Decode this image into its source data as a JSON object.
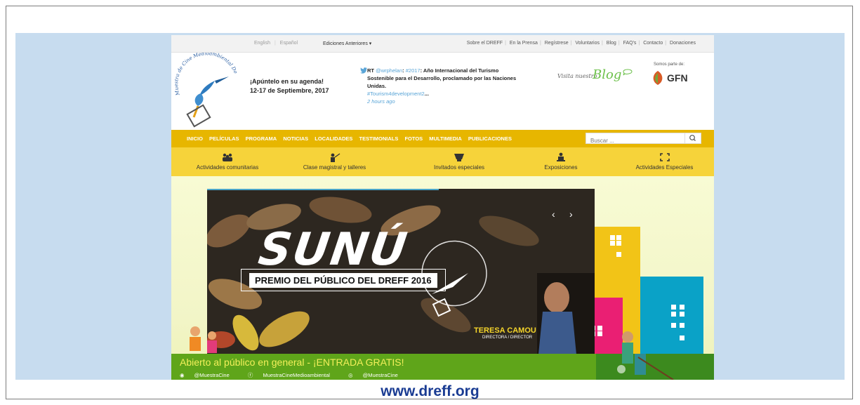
{
  "topbar": {
    "lang_english": "English",
    "lang_espanol": "Español",
    "ediciones": "Ediciones Anteriores",
    "links": [
      "Sobre el DREFF",
      "En la Prensa",
      "Regístrese",
      "Voluntarios",
      "Blog",
      "FAQ's",
      "Contacto",
      "Donaciones"
    ]
  },
  "logo": {
    "text": "Muestra de Cine Medioambiental Dominicana"
  },
  "agenda": {
    "line1": "¡Apúntelo en su agenda!",
    "line2": "12-17 de Septiembre, 2017"
  },
  "tweet": {
    "rt": "RT",
    "mention": "@wrphelan",
    "colon": ":",
    "hashtag": "#2017",
    "text": ": Año Internacional del Turismo Sostenible para el Desarrollo, proclamado por las Naciones Unidas.",
    "link": "#Tourism4development2",
    "ellipsis": "...",
    "time": "2 hours ago"
  },
  "blog": {
    "visita": "Visita nuestro",
    "word": "Blog"
  },
  "gfn": {
    "somos": "Somos parte de:",
    "name": "GFN"
  },
  "nav": {
    "items": [
      "INICIO",
      "PELÍCULAS",
      "PROGRAMA",
      "NOTICIAS",
      "LOCALIDADES",
      "TESTIMONIALS",
      "FOTOS",
      "MULTIMEDIA",
      "PUBLICACIONES"
    ],
    "search_placeholder": "Buscar ..."
  },
  "subnav": {
    "items": [
      "Actividades comunitarias",
      "Clase magistral y talleres",
      "Invitados especiales",
      "Exposiciones",
      "Actividades Especiales"
    ]
  },
  "slider": {
    "title": "SUNÚ",
    "premio": "PREMIO DEL PÚBLICO DEL DREFF 2016",
    "name": "TERESA CAMOU",
    "role": "DIRECTORA / DIRECTOR",
    "badge": "Muestra de Cine Medioambiental Dominicana"
  },
  "band": {
    "title": "Abierto al público en general - ¡ENTRADA GRATIS!",
    "twitter": "@MuestraCine",
    "facebook": "MuestraCineMedioambiental",
    "instagram": "@MuestraCine"
  },
  "caption": "www.dreff.org",
  "colors": {
    "nav": "#e7b600",
    "subnav": "#f6d33a",
    "caption": "#1a3c93",
    "band": "#5fa51a"
  }
}
